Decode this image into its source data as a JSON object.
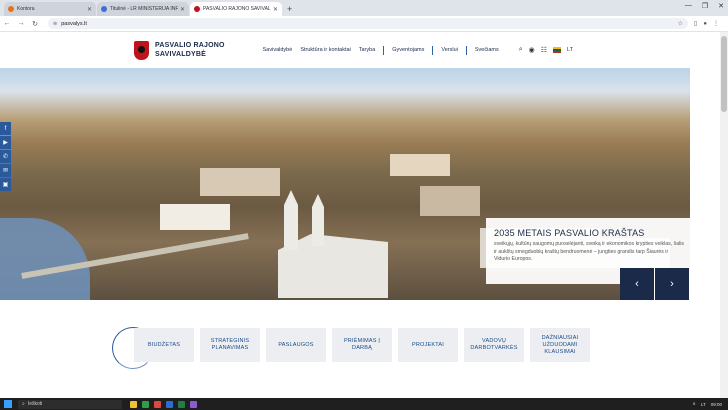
{
  "browser": {
    "tabs": [
      {
        "label": "Kontora",
        "fav": "#e8711b",
        "active": false
      },
      {
        "label": "Titulinė - LR MINISTERIJA INF...",
        "fav": "#3b6fd8",
        "active": false
      },
      {
        "label": "PASVALIO RAJONO SAVIVALDY...",
        "fav": "#c0121a",
        "active": true
      }
    ],
    "new_tab": "+",
    "url": "pasvalys.lt",
    "window_controls": [
      "—",
      "❐",
      "✕"
    ]
  },
  "header": {
    "logo_line1": "PASVALIO RAJONO",
    "logo_line2": "SAVIVALDYBĖ",
    "nav": [
      "Savivaldybė",
      "Struktūra ir kontaktai",
      "Taryba",
      "Gyventojams",
      "Verslui",
      "Svečiams"
    ],
    "lang": "LT"
  },
  "hero": {
    "title": "2035 METAIS PASVALIO KRAŠTAS",
    "text": "sveikųjų, kultūrų saugomų puoselėjanti, sveiką ir ekonomikos krypties veiklas, šalis ir aukštų smegduobių kraštų bendruomenė – jungties grandis tarp Šiaurės ir Vidurio Europos.",
    "prev": "‹",
    "next": "›"
  },
  "social": [
    "f",
    "▶",
    "✆",
    "✉",
    "▣"
  ],
  "quick_links": [
    "BIUDŽETAS",
    "STRATEGINIS PLANAVIMAS",
    "PASLAUGOS",
    "PRIĖMIMAS Į DARBĄ",
    "PROJEKTAI",
    "VADOVŲ DARBOTVARKĖS",
    "DAŽNIAUSIAI UŽDUODAMI KLAUSIMAI"
  ],
  "taskbar": {
    "search_placeholder": "Ieškoti",
    "tray": [
      "∧",
      "LT",
      "09:00"
    ]
  }
}
